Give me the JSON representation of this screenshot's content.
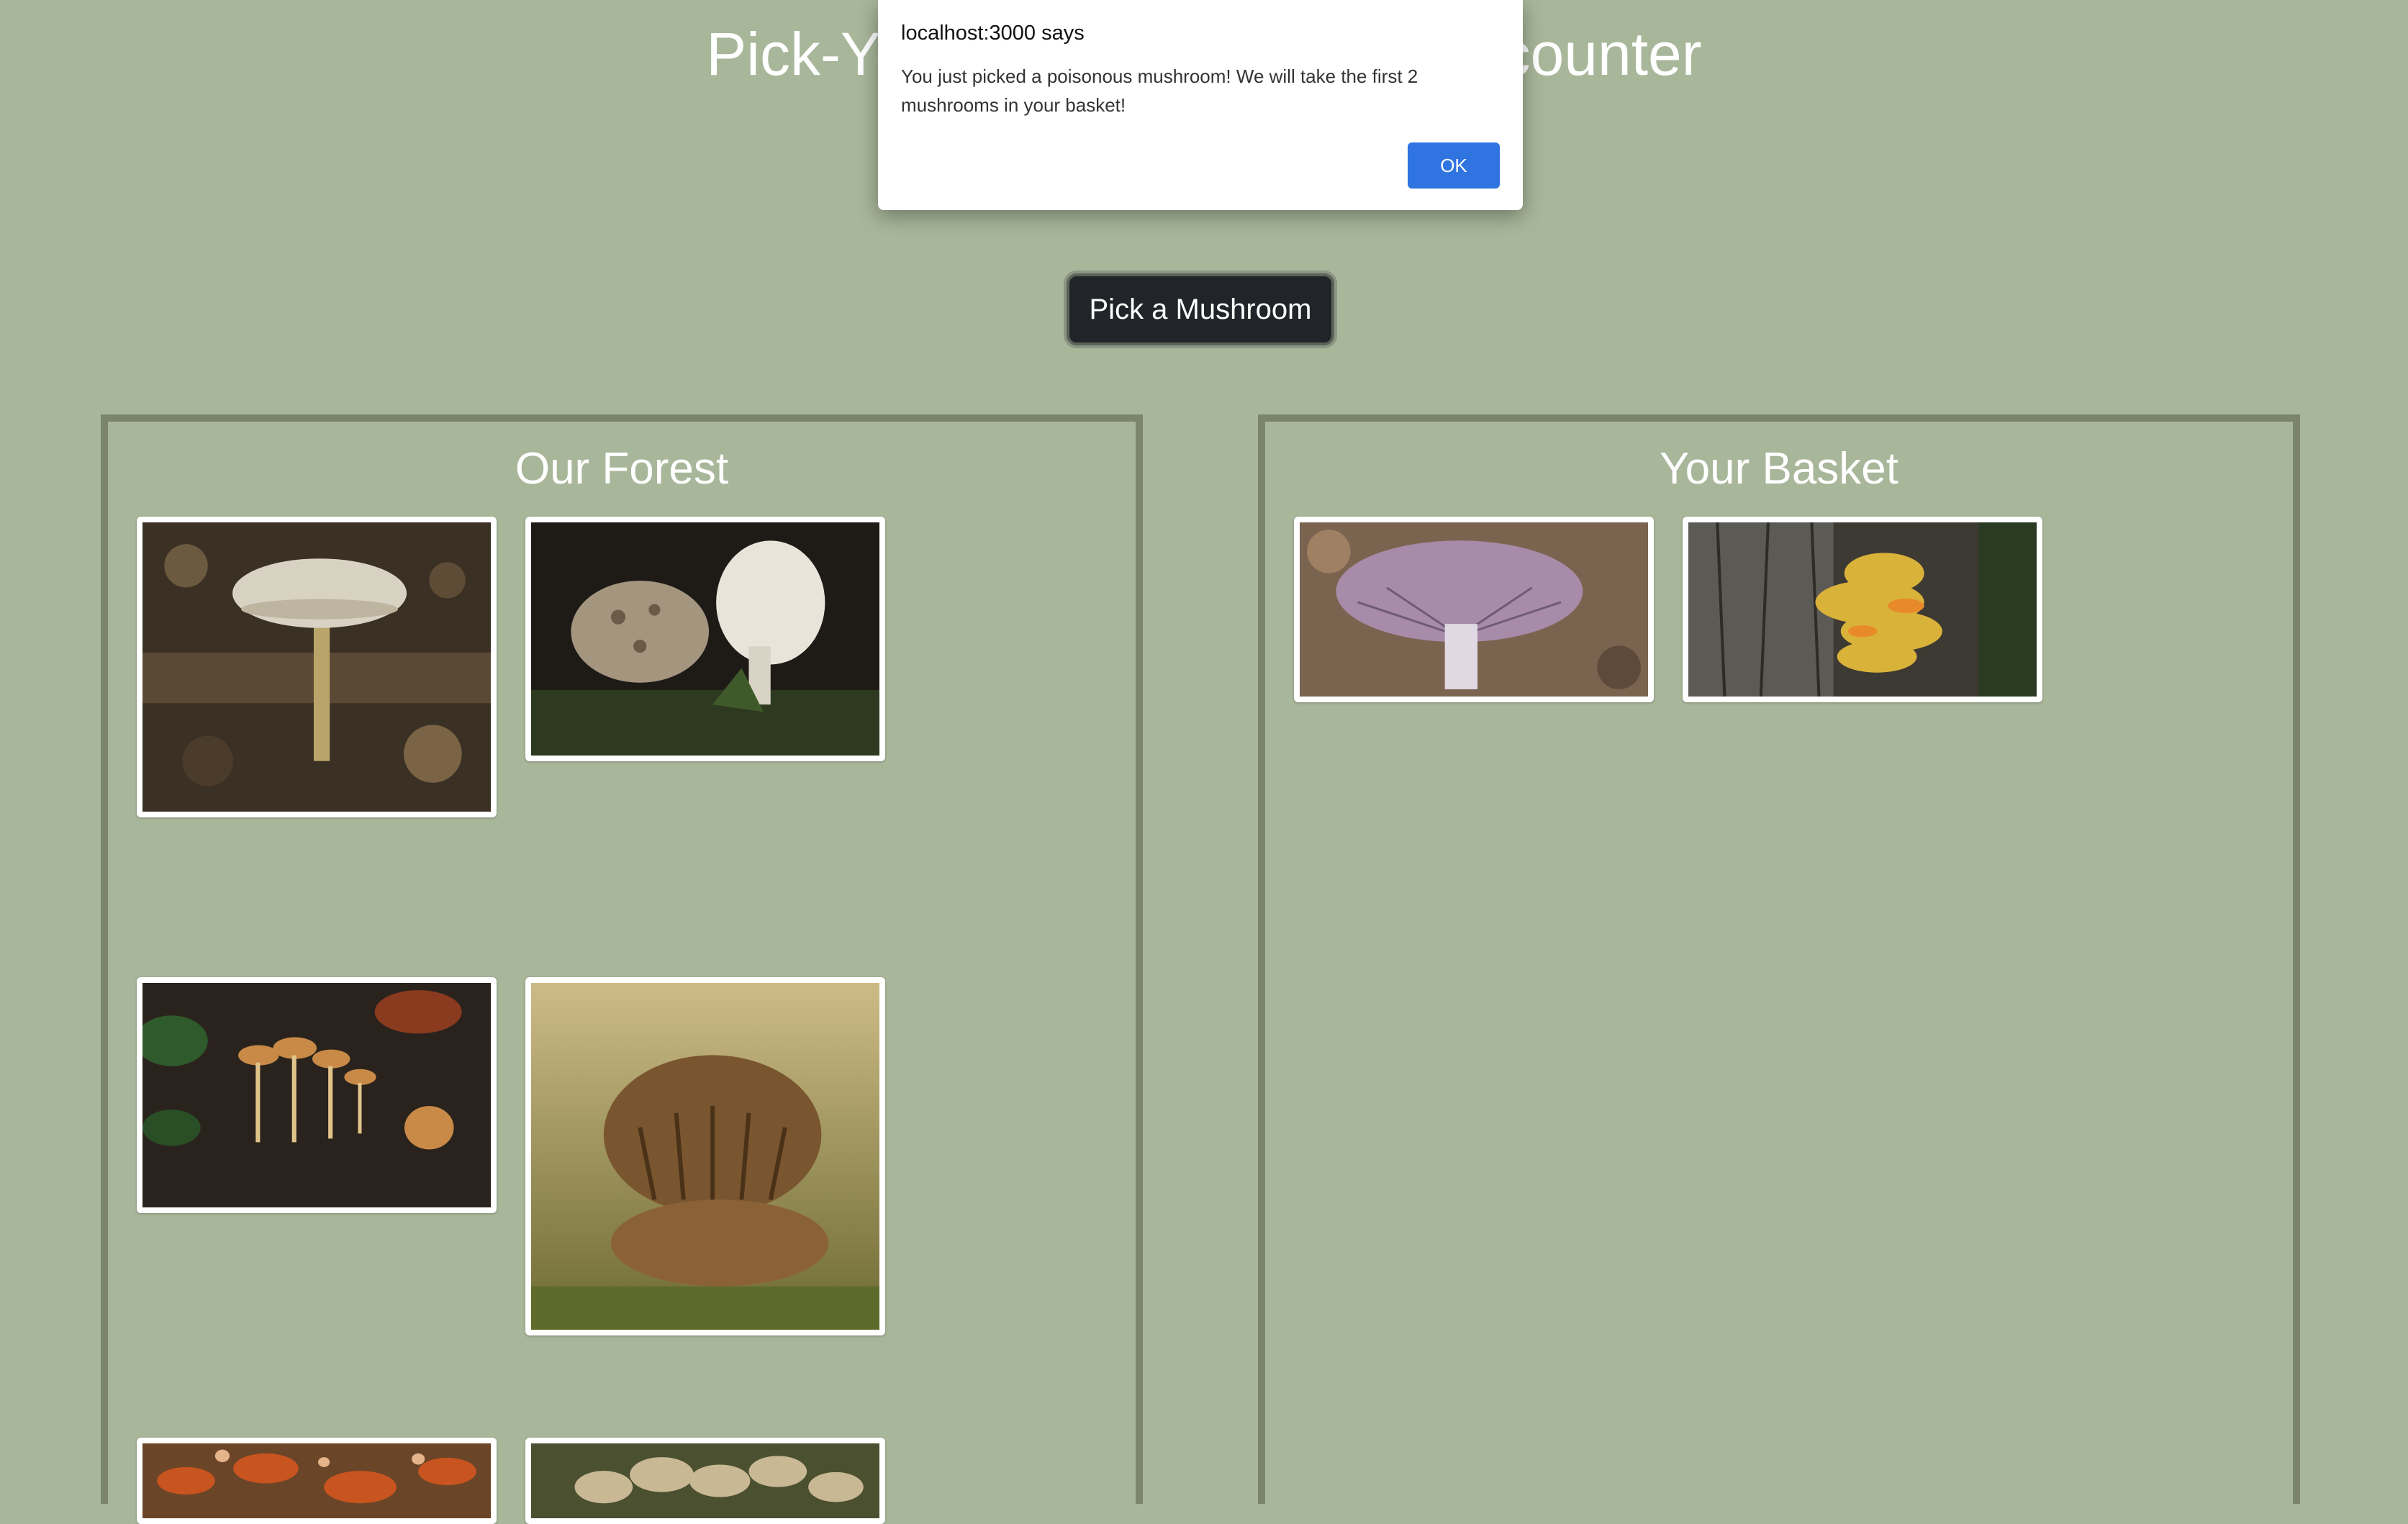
{
  "page": {
    "title": "Pick-Your-Own Mushroom Encounter",
    "pick_button": "Pick a Mushroom"
  },
  "forest": {
    "title": "Our Forest",
    "cards": [
      {
        "name": "pale-cap-mushroom-photo"
      },
      {
        "name": "white-mushrooms-pair-photo"
      },
      {
        "name": "orange-cluster-mushrooms-photo"
      },
      {
        "name": "brown-gilled-mushroom-photo"
      },
      {
        "name": "red-shelf-mushrooms-photo"
      },
      {
        "name": "tan-cluster-mushrooms-photo"
      }
    ]
  },
  "basket": {
    "title": "Your Basket",
    "cards": [
      {
        "name": "purple-gilled-mushroom-photo"
      },
      {
        "name": "yellow-shelf-fungus-photo"
      }
    ]
  },
  "dialog": {
    "origin": "localhost:3000 says",
    "message": "You just picked a poisonous mushroom! We will take the first 2 mushrooms in your basket!",
    "ok_label": "OK"
  },
  "colors": {
    "background": "#a8b69a",
    "panel_border": "#7a8569",
    "button_dark": "#212529",
    "dialog_ok": "#2f74e0"
  }
}
